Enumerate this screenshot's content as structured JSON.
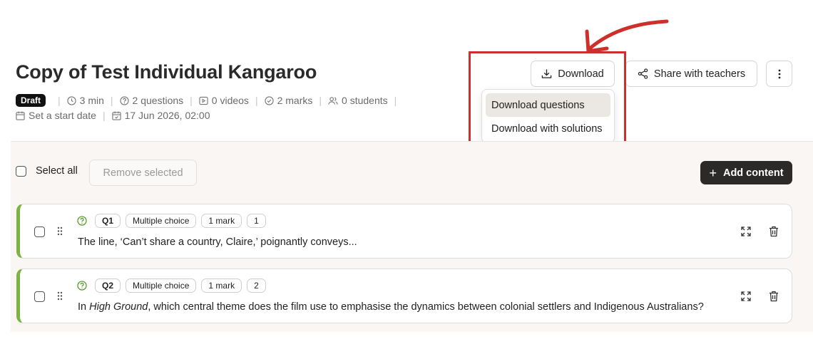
{
  "header": {
    "title": "Copy of Test Individual Kangaroo",
    "status_badge": "Draft",
    "meta": {
      "duration": "3 min",
      "questions": "2 questions",
      "videos": "0 videos",
      "marks": "2 marks",
      "students": "0 students",
      "start_date": "Set a start date",
      "end_date": "17 Jun 2026, 02:00"
    }
  },
  "toolbar": {
    "download_label": "Download",
    "share_label": "Share with teachers",
    "more_icon": "vertical-dots-icon"
  },
  "download_menu": {
    "items": [
      "Download questions",
      "Download with solutions"
    ],
    "hovered_index": 0
  },
  "annotation": {
    "highlight_color": "#cf2f2a"
  },
  "list_toolbar": {
    "select_all_label": "Select all",
    "remove_selected_label": "Remove selected",
    "add_content_label": "Add content"
  },
  "questions": [
    {
      "number": "Q1",
      "type": "Multiple choice",
      "marks": "1 mark",
      "position": "1",
      "text": "The line, ‘Can’t share a country, Claire,’ poignantly conveys..."
    },
    {
      "number": "Q2",
      "type": "Multiple choice",
      "marks": "1 mark",
      "position": "2",
      "text_before": "In ",
      "text_italic": "High Ground",
      "text_after": ", which central theme does the film use to emphasise the dynamics between colonial settlers and Indigenous Australians?"
    }
  ],
  "colors": {
    "accent_green": "#7cb342",
    "dark_button": "#2b2a29",
    "panel_bg": "#faf6f3"
  }
}
